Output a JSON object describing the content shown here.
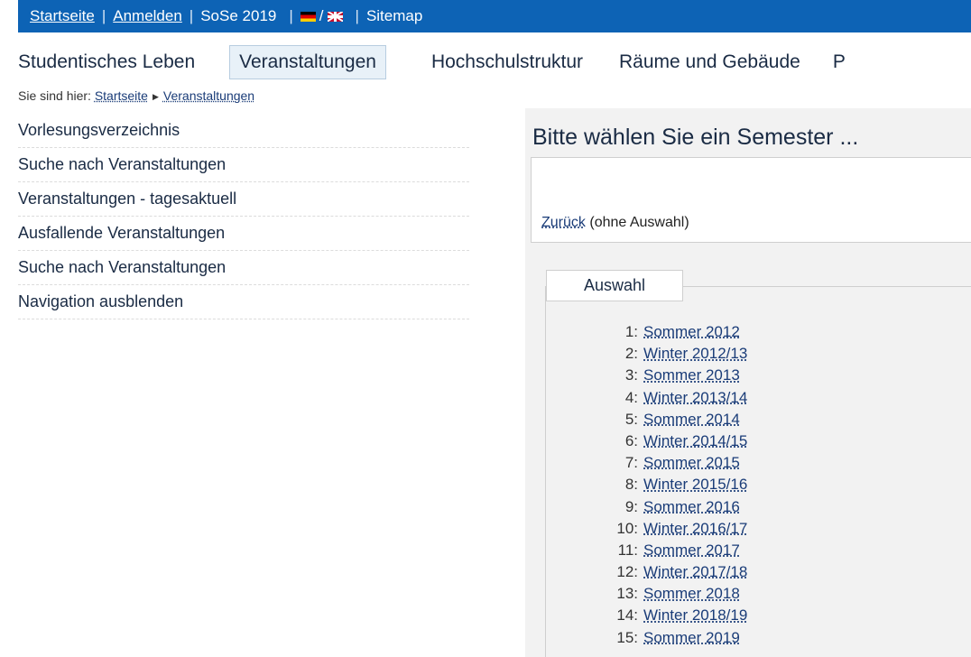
{
  "topbar": {
    "home": "Startseite",
    "login": "Anmelden",
    "semester": "SoSe 2019",
    "lang_sep": "/",
    "sitemap": "Sitemap",
    "separator": "|",
    "bg_color": "#0d63b5"
  },
  "mainnav": {
    "items": [
      "Studentisches Leben",
      "Veranstaltungen",
      "Hochschulstruktur",
      "Räume und Gebäude",
      "P"
    ],
    "active_index": 1
  },
  "breadcrumb": {
    "prefix": "Sie sind hier:",
    "items": [
      "Startseite",
      "Veranstaltungen"
    ]
  },
  "sidebar": {
    "items": [
      "Vorlesungsverzeichnis",
      "Suche nach Veranstaltungen",
      "Veranstaltungen - tagesaktuell",
      "Ausfallende Veranstaltungen",
      "Suche nach Veranstaltungen",
      "Navigation ausblenden"
    ]
  },
  "content": {
    "title": "Bitte wählen Sie ein Semester ...",
    "back_link": "Zurück",
    "back_note": "(ohne Auswahl)",
    "legend": "Auswahl",
    "semesters": [
      {
        "num": "1:",
        "label": "Sommer 2012"
      },
      {
        "num": "2:",
        "label": "Winter 2012/13"
      },
      {
        "num": "3:",
        "label": "Sommer 2013"
      },
      {
        "num": "4:",
        "label": "Winter 2013/14"
      },
      {
        "num": "5:",
        "label": "Sommer 2014"
      },
      {
        "num": "6:",
        "label": "Winter 2014/15"
      },
      {
        "num": "7:",
        "label": "Sommer 2015"
      },
      {
        "num": "8:",
        "label": "Winter 2015/16"
      },
      {
        "num": "9:",
        "label": "Sommer 2016"
      },
      {
        "num": "10:",
        "label": "Winter 2016/17"
      },
      {
        "num": "11:",
        "label": "Sommer 2017"
      },
      {
        "num": "12:",
        "label": "Winter 2017/18"
      },
      {
        "num": "13:",
        "label": "Sommer 2018"
      },
      {
        "num": "14:",
        "label": "Winter 2018/19"
      },
      {
        "num": "15:",
        "label": "Sommer 2019"
      }
    ]
  }
}
